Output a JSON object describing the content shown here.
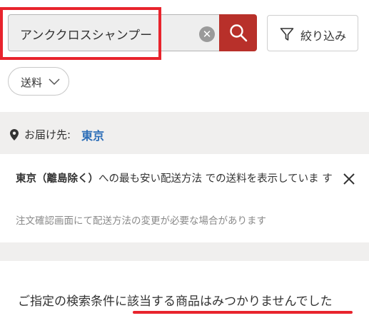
{
  "search": {
    "query": "アンククロスシャンプー",
    "clear_icon": "clear-circle-icon",
    "search_icon": "magnifier-icon"
  },
  "filter": {
    "label": "絞り込み",
    "icon": "funnel-icon"
  },
  "shipping_chip": {
    "label": "送料",
    "icon": "chevron-down-icon"
  },
  "delivery": {
    "label": "お届け先:",
    "city": "東京",
    "icon": "location-pin-icon"
  },
  "notice": {
    "emphasis": "東京（離島除く）",
    "rest": "への最も安い配送方法 での送料を表示していま す",
    "sub": "注文確認画面にて配送方法の変更が必要な場合があります",
    "close_icon": "close-icon"
  },
  "result": {
    "message": "ご指定の検索条件に該当する商品はみつかりませんでした"
  },
  "colors": {
    "accent": "#b8302a",
    "annotation_red": "#e8242d",
    "link_blue": "#2e6fb8",
    "background_gray": "#f0efee"
  }
}
